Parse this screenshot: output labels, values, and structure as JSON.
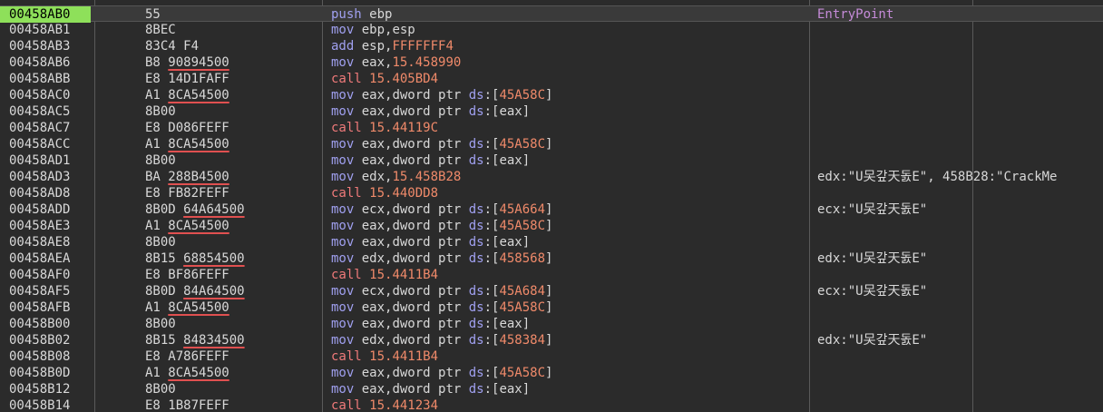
{
  "rows": [
    {
      "addr": "00458AB0",
      "bytes": [
        {
          "t": "55"
        }
      ],
      "asm": [
        {
          "c": "mn-push",
          "t": "push "
        },
        {
          "c": "reg",
          "t": "ebp"
        }
      ],
      "comment": "EntryPoint",
      "current": true
    },
    {
      "addr": "00458AB1",
      "bytes": [
        {
          "t": "8BEC"
        }
      ],
      "asm": [
        {
          "c": "mn-mov",
          "t": "mov "
        },
        {
          "c": "reg",
          "t": "ebp"
        },
        {
          "c": "kw",
          "t": ","
        },
        {
          "c": "reg",
          "t": "esp"
        }
      ],
      "comment": ""
    },
    {
      "addr": "00458AB3",
      "bytes": [
        {
          "t": "83C4 F4"
        }
      ],
      "asm": [
        {
          "c": "mn-mov",
          "t": "add "
        },
        {
          "c": "reg",
          "t": "esp"
        },
        {
          "c": "kw",
          "t": ","
        },
        {
          "c": "imm",
          "t": "FFFFFFF4"
        }
      ],
      "comment": ""
    },
    {
      "addr": "00458AB6",
      "bytes": [
        {
          "t": "B8 "
        },
        {
          "t": "90894500",
          "u": true
        }
      ],
      "asm": [
        {
          "c": "mn-mov",
          "t": "mov "
        },
        {
          "c": "reg",
          "t": "eax"
        },
        {
          "c": "kw",
          "t": ","
        },
        {
          "c": "imm",
          "t": "15.458990"
        }
      ],
      "comment": ""
    },
    {
      "addr": "00458ABB",
      "bytes": [
        {
          "t": "E8 14D1FAFF"
        }
      ],
      "asm": [
        {
          "c": "mn-call",
          "t": "call "
        },
        {
          "c": "imm",
          "t": "15.405BD4"
        }
      ],
      "comment": ""
    },
    {
      "addr": "00458AC0",
      "bytes": [
        {
          "t": "A1 "
        },
        {
          "t": "8CA54500",
          "u": true
        }
      ],
      "asm": [
        {
          "c": "mn-mov",
          "t": "mov "
        },
        {
          "c": "reg",
          "t": "eax"
        },
        {
          "c": "kw",
          "t": ",dword ptr "
        },
        {
          "c": "seg",
          "t": "ds"
        },
        {
          "c": "kw",
          "t": ":["
        },
        {
          "c": "imm",
          "t": "45A58C"
        },
        {
          "c": "kw",
          "t": "]"
        }
      ],
      "comment": ""
    },
    {
      "addr": "00458AC5",
      "bytes": [
        {
          "t": "8B00"
        }
      ],
      "asm": [
        {
          "c": "mn-mov",
          "t": "mov "
        },
        {
          "c": "reg",
          "t": "eax"
        },
        {
          "c": "kw",
          "t": ",dword ptr "
        },
        {
          "c": "seg",
          "t": "ds"
        },
        {
          "c": "kw",
          "t": ":["
        },
        {
          "c": "reg",
          "t": "eax"
        },
        {
          "c": "kw",
          "t": "]"
        }
      ],
      "comment": ""
    },
    {
      "addr": "00458AC7",
      "bytes": [
        {
          "t": "E8 D086FEFF"
        }
      ],
      "asm": [
        {
          "c": "mn-call",
          "t": "call "
        },
        {
          "c": "imm",
          "t": "15.44119C"
        }
      ],
      "comment": ""
    },
    {
      "addr": "00458ACC",
      "bytes": [
        {
          "t": "A1 "
        },
        {
          "t": "8CA54500",
          "u": true
        }
      ],
      "asm": [
        {
          "c": "mn-mov",
          "t": "mov "
        },
        {
          "c": "reg",
          "t": "eax"
        },
        {
          "c": "kw",
          "t": ",dword ptr "
        },
        {
          "c": "seg",
          "t": "ds"
        },
        {
          "c": "kw",
          "t": ":["
        },
        {
          "c": "imm",
          "t": "45A58C"
        },
        {
          "c": "kw",
          "t": "]"
        }
      ],
      "comment": ""
    },
    {
      "addr": "00458AD1",
      "bytes": [
        {
          "t": "8B00"
        }
      ],
      "asm": [
        {
          "c": "mn-mov",
          "t": "mov "
        },
        {
          "c": "reg",
          "t": "eax"
        },
        {
          "c": "kw",
          "t": ",dword ptr "
        },
        {
          "c": "seg",
          "t": "ds"
        },
        {
          "c": "kw",
          "t": ":["
        },
        {
          "c": "reg",
          "t": "eax"
        },
        {
          "c": "kw",
          "t": "]"
        }
      ],
      "comment": ""
    },
    {
      "addr": "00458AD3",
      "bytes": [
        {
          "t": "BA "
        },
        {
          "t": "288B4500",
          "u": true
        }
      ],
      "asm": [
        {
          "c": "mn-mov",
          "t": "mov "
        },
        {
          "c": "reg",
          "t": "edx"
        },
        {
          "c": "kw",
          "t": ","
        },
        {
          "c": "imm",
          "t": "15.458B28"
        }
      ],
      "comment": "edx:\"U㕦갚天돐E\", 458B28:\"CrackMe"
    },
    {
      "addr": "00458AD8",
      "bytes": [
        {
          "t": "E8 FB82FEFF"
        }
      ],
      "asm": [
        {
          "c": "mn-call",
          "t": "call "
        },
        {
          "c": "imm",
          "t": "15.440DD8"
        }
      ],
      "comment": ""
    },
    {
      "addr": "00458ADD",
      "bytes": [
        {
          "t": "8B0D "
        },
        {
          "t": "64A64500",
          "u": true
        }
      ],
      "asm": [
        {
          "c": "mn-mov",
          "t": "mov "
        },
        {
          "c": "reg",
          "t": "ecx"
        },
        {
          "c": "kw",
          "t": ",dword ptr "
        },
        {
          "c": "seg",
          "t": "ds"
        },
        {
          "c": "kw",
          "t": ":["
        },
        {
          "c": "imm",
          "t": "45A664"
        },
        {
          "c": "kw",
          "t": "]"
        }
      ],
      "comment": "ecx:\"U㕦갚天돐E\""
    },
    {
      "addr": "00458AE3",
      "bytes": [
        {
          "t": "A1 "
        },
        {
          "t": "8CA54500",
          "u": true
        }
      ],
      "asm": [
        {
          "c": "mn-mov",
          "t": "mov "
        },
        {
          "c": "reg",
          "t": "eax"
        },
        {
          "c": "kw",
          "t": ",dword ptr "
        },
        {
          "c": "seg",
          "t": "ds"
        },
        {
          "c": "kw",
          "t": ":["
        },
        {
          "c": "imm",
          "t": "45A58C"
        },
        {
          "c": "kw",
          "t": "]"
        }
      ],
      "comment": ""
    },
    {
      "addr": "00458AE8",
      "bytes": [
        {
          "t": "8B00"
        }
      ],
      "asm": [
        {
          "c": "mn-mov",
          "t": "mov "
        },
        {
          "c": "reg",
          "t": "eax"
        },
        {
          "c": "kw",
          "t": ",dword ptr "
        },
        {
          "c": "seg",
          "t": "ds"
        },
        {
          "c": "kw",
          "t": ":["
        },
        {
          "c": "reg",
          "t": "eax"
        },
        {
          "c": "kw",
          "t": "]"
        }
      ],
      "comment": ""
    },
    {
      "addr": "00458AEA",
      "bytes": [
        {
          "t": "8B15 "
        },
        {
          "t": "68854500",
          "u": true
        }
      ],
      "asm": [
        {
          "c": "mn-mov",
          "t": "mov "
        },
        {
          "c": "reg",
          "t": "edx"
        },
        {
          "c": "kw",
          "t": ",dword ptr "
        },
        {
          "c": "seg",
          "t": "ds"
        },
        {
          "c": "kw",
          "t": ":["
        },
        {
          "c": "imm",
          "t": "458568"
        },
        {
          "c": "kw",
          "t": "]"
        }
      ],
      "comment": "edx:\"U㕦갚天돐E\""
    },
    {
      "addr": "00458AF0",
      "bytes": [
        {
          "t": "E8 BF86FEFF"
        }
      ],
      "asm": [
        {
          "c": "mn-call",
          "t": "call "
        },
        {
          "c": "imm",
          "t": "15.4411B4"
        }
      ],
      "comment": ""
    },
    {
      "addr": "00458AF5",
      "bytes": [
        {
          "t": "8B0D "
        },
        {
          "t": "84A64500",
          "u": true
        }
      ],
      "asm": [
        {
          "c": "mn-mov",
          "t": "mov "
        },
        {
          "c": "reg",
          "t": "ecx"
        },
        {
          "c": "kw",
          "t": ",dword ptr "
        },
        {
          "c": "seg",
          "t": "ds"
        },
        {
          "c": "kw",
          "t": ":["
        },
        {
          "c": "imm",
          "t": "45A684"
        },
        {
          "c": "kw",
          "t": "]"
        }
      ],
      "comment": "ecx:\"U㕦갚天돐E\""
    },
    {
      "addr": "00458AFB",
      "bytes": [
        {
          "t": "A1 "
        },
        {
          "t": "8CA54500",
          "u": true
        }
      ],
      "asm": [
        {
          "c": "mn-mov",
          "t": "mov "
        },
        {
          "c": "reg",
          "t": "eax"
        },
        {
          "c": "kw",
          "t": ",dword ptr "
        },
        {
          "c": "seg",
          "t": "ds"
        },
        {
          "c": "kw",
          "t": ":["
        },
        {
          "c": "imm",
          "t": "45A58C"
        },
        {
          "c": "kw",
          "t": "]"
        }
      ],
      "comment": ""
    },
    {
      "addr": "00458B00",
      "bytes": [
        {
          "t": "8B00"
        }
      ],
      "asm": [
        {
          "c": "mn-mov",
          "t": "mov "
        },
        {
          "c": "reg",
          "t": "eax"
        },
        {
          "c": "kw",
          "t": ",dword ptr "
        },
        {
          "c": "seg",
          "t": "ds"
        },
        {
          "c": "kw",
          "t": ":["
        },
        {
          "c": "reg",
          "t": "eax"
        },
        {
          "c": "kw",
          "t": "]"
        }
      ],
      "comment": ""
    },
    {
      "addr": "00458B02",
      "bytes": [
        {
          "t": "8B15 "
        },
        {
          "t": "84834500",
          "u": true
        }
      ],
      "asm": [
        {
          "c": "mn-mov",
          "t": "mov "
        },
        {
          "c": "reg",
          "t": "edx"
        },
        {
          "c": "kw",
          "t": ",dword ptr "
        },
        {
          "c": "seg",
          "t": "ds"
        },
        {
          "c": "kw",
          "t": ":["
        },
        {
          "c": "imm",
          "t": "458384"
        },
        {
          "c": "kw",
          "t": "]"
        }
      ],
      "comment": "edx:\"U㕦갚天돐E\""
    },
    {
      "addr": "00458B08",
      "bytes": [
        {
          "t": "E8 A786FEFF"
        }
      ],
      "asm": [
        {
          "c": "mn-call",
          "t": "call "
        },
        {
          "c": "imm",
          "t": "15.4411B4"
        }
      ],
      "comment": ""
    },
    {
      "addr": "00458B0D",
      "bytes": [
        {
          "t": "A1 "
        },
        {
          "t": "8CA54500",
          "u": true
        }
      ],
      "asm": [
        {
          "c": "mn-mov",
          "t": "mov "
        },
        {
          "c": "reg",
          "t": "eax"
        },
        {
          "c": "kw",
          "t": ",dword ptr "
        },
        {
          "c": "seg",
          "t": "ds"
        },
        {
          "c": "kw",
          "t": ":["
        },
        {
          "c": "imm",
          "t": "45A58C"
        },
        {
          "c": "kw",
          "t": "]"
        }
      ],
      "comment": ""
    },
    {
      "addr": "00458B12",
      "bytes": [
        {
          "t": "8B00"
        }
      ],
      "asm": [
        {
          "c": "mn-mov",
          "t": "mov "
        },
        {
          "c": "reg",
          "t": "eax"
        },
        {
          "c": "kw",
          "t": ",dword ptr "
        },
        {
          "c": "seg",
          "t": "ds"
        },
        {
          "c": "kw",
          "t": ":["
        },
        {
          "c": "reg",
          "t": "eax"
        },
        {
          "c": "kw",
          "t": "]"
        }
      ],
      "comment": ""
    },
    {
      "addr": "00458B14",
      "bytes": [
        {
          "t": "E8 1B87FEFF"
        }
      ],
      "asm": [
        {
          "c": "mn-call",
          "t": "call "
        },
        {
          "c": "imm",
          "t": "15.441234"
        }
      ],
      "comment": ""
    }
  ]
}
